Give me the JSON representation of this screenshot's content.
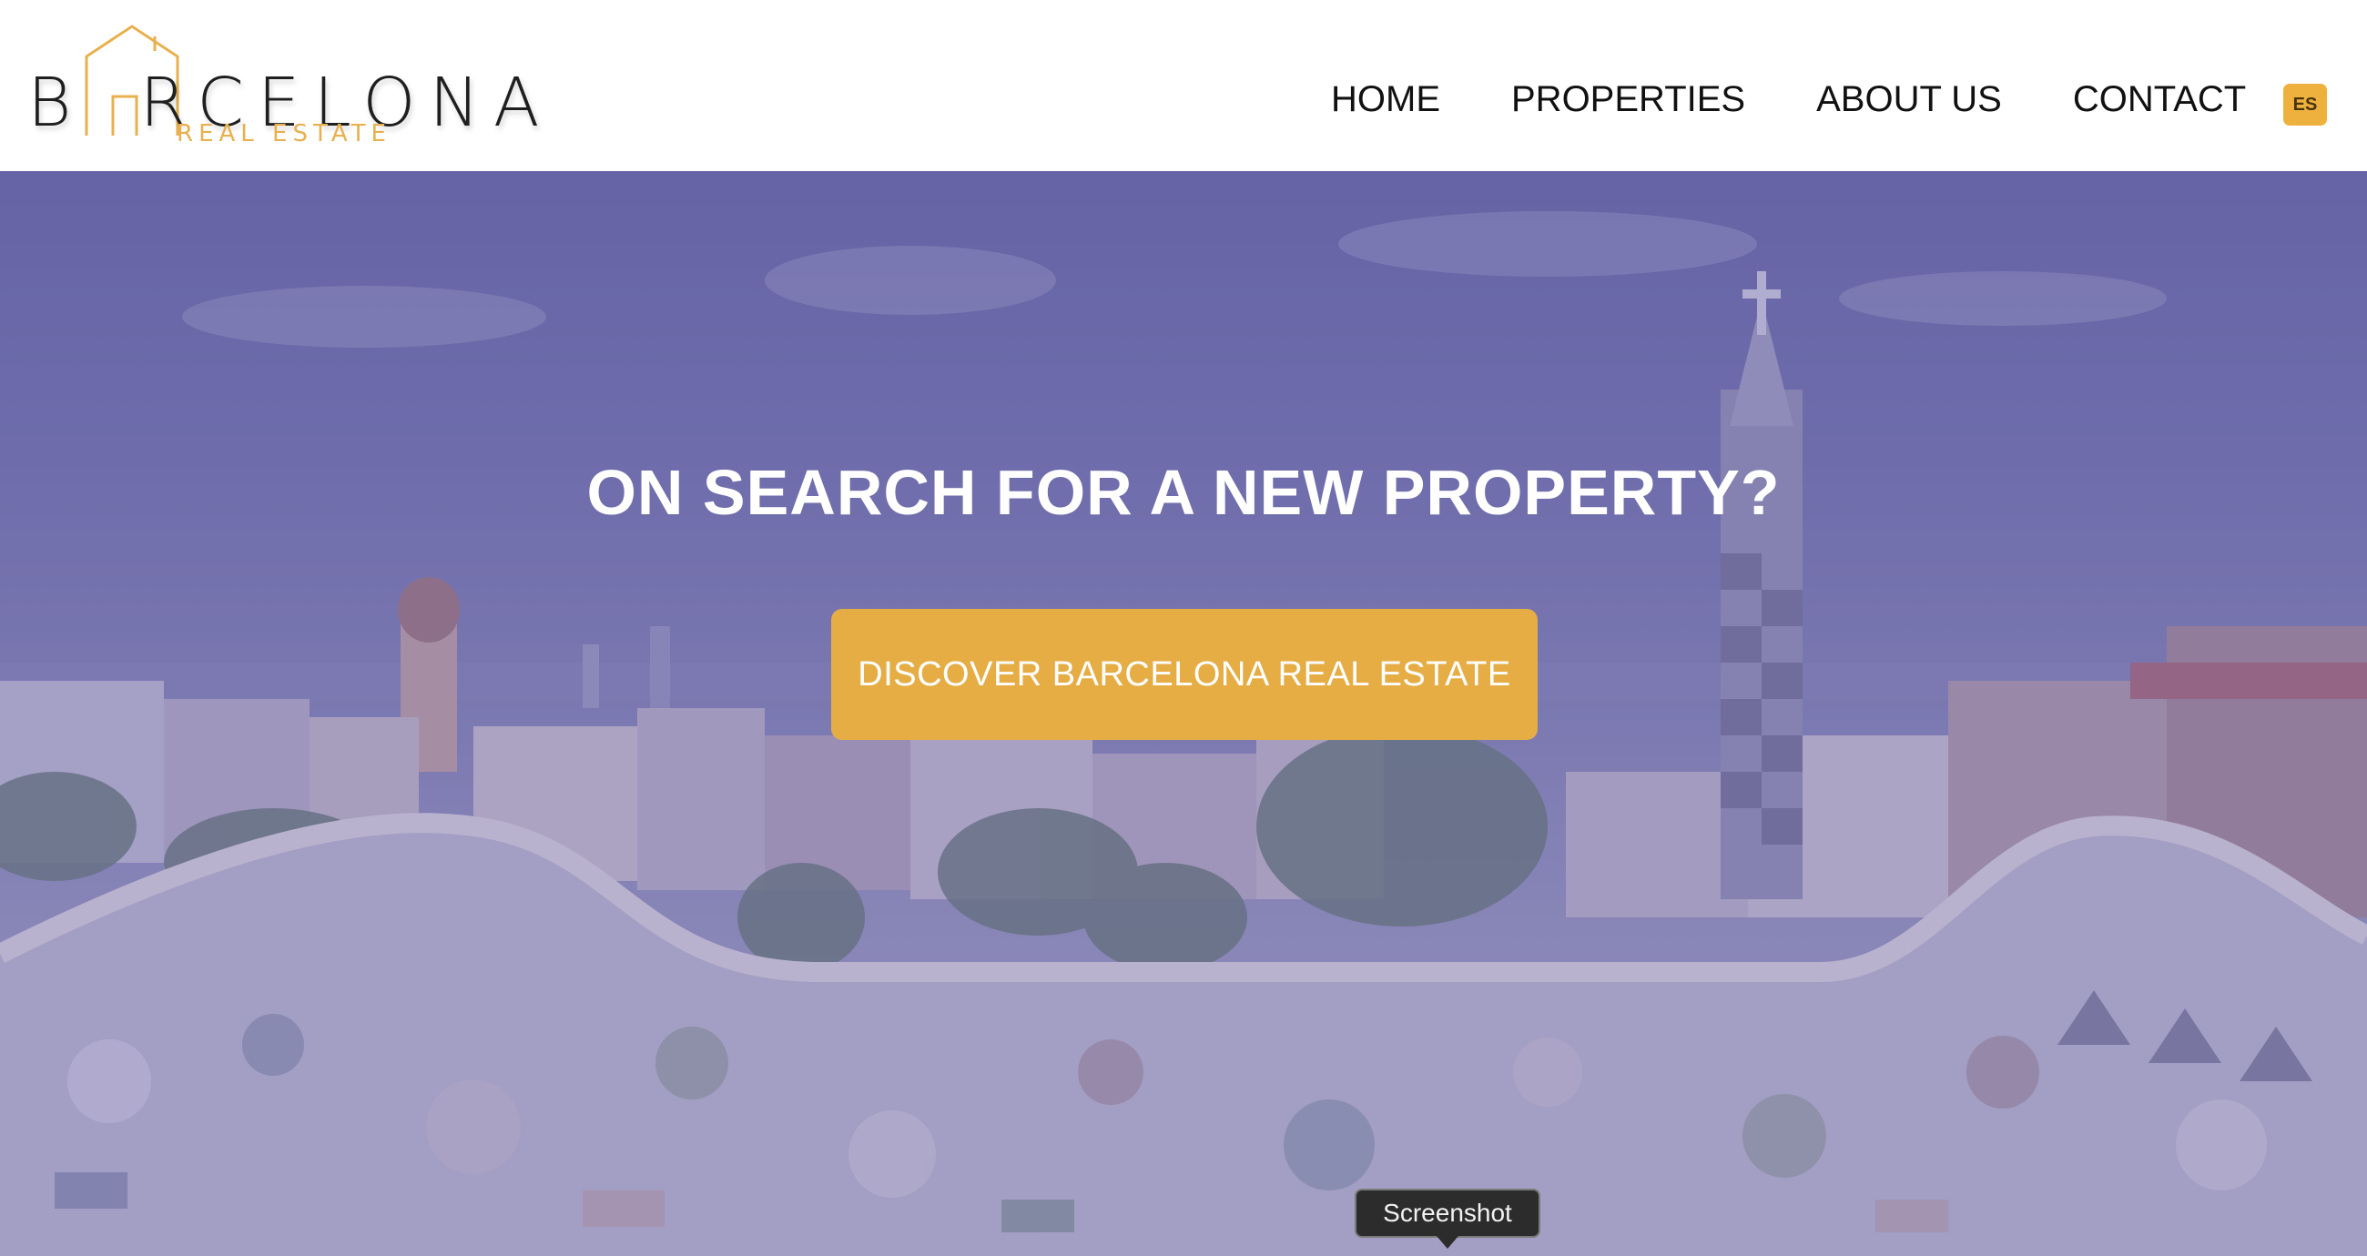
{
  "header": {
    "logo": {
      "word": "B  RCELONA",
      "word_prefix": "B",
      "word_suffix": "RCELONA",
      "subtitle": "REAL ESTATE",
      "icon": "house-outline-icon",
      "accent_color": "#e8b04e"
    },
    "nav": [
      {
        "label": "HOME"
      },
      {
        "label": "PROPERTIES"
      },
      {
        "label": "ABOUT US"
      },
      {
        "label": "CONTACT"
      }
    ],
    "language": {
      "label": "ES",
      "color": "#eeb13d"
    }
  },
  "hero": {
    "title": "ON SEARCH FOR A NEW PROPERTY?",
    "cta_label": "DISCOVER BARCELONA REAL ESTATE",
    "cta_color": "#e6ad45",
    "overlay_color": "#5652a0",
    "background_image": "barcelona-park-guell-mosaic-skyline"
  },
  "tooltip": {
    "text": "Screenshot"
  }
}
